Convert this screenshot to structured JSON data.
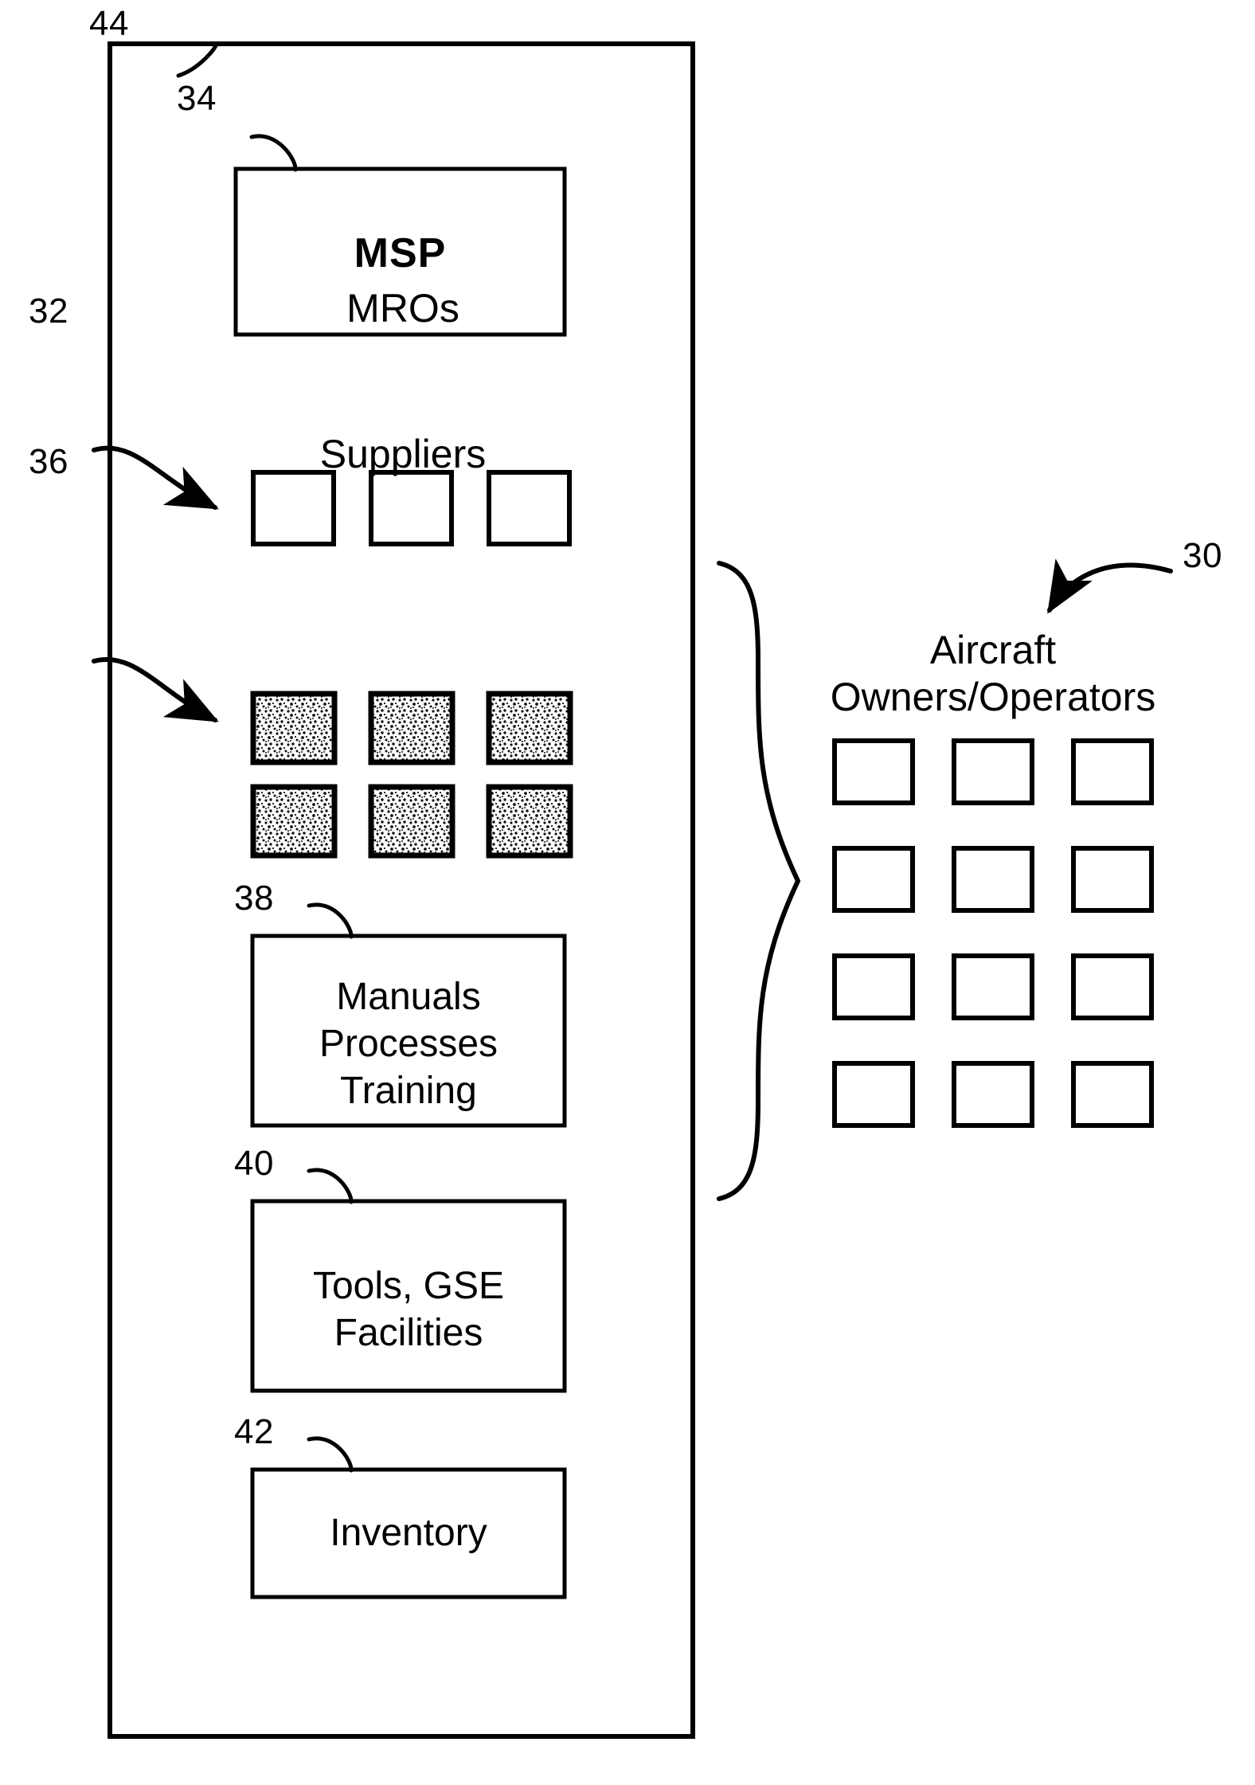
{
  "figure": {
    "type": "patent-diagram",
    "background": "#ffffff",
    "line_color": "#000000"
  },
  "reference_numerals": {
    "outer_container": "44",
    "msp_box": "34",
    "mros_group": "32",
    "suppliers_group": "36",
    "manuals_box": "38",
    "tools_box": "40",
    "inventory_box": "42",
    "aircraft_owners_group": "30"
  },
  "msp": {
    "label": "MSP"
  },
  "mros": {
    "title": "MROs",
    "box_count": 3,
    "fill": "none"
  },
  "suppliers": {
    "title": "Suppliers",
    "box_count": 6,
    "rows": 2,
    "columns": 3,
    "fill": "stipple"
  },
  "manuals": {
    "lines": [
      "Manuals",
      "Processes",
      "Training"
    ]
  },
  "tools": {
    "lines": [
      "Tools, GSE",
      "Facilities"
    ]
  },
  "inventory": {
    "label": "Inventory"
  },
  "aircraft_owners": {
    "title_lines": [
      "Aircraft",
      "Owners/Operators"
    ],
    "box_count": 12,
    "rows": 4,
    "columns": 3,
    "fill": "none"
  },
  "brace": {
    "name": "right-pointing-brace",
    "orientation": "points-right"
  }
}
